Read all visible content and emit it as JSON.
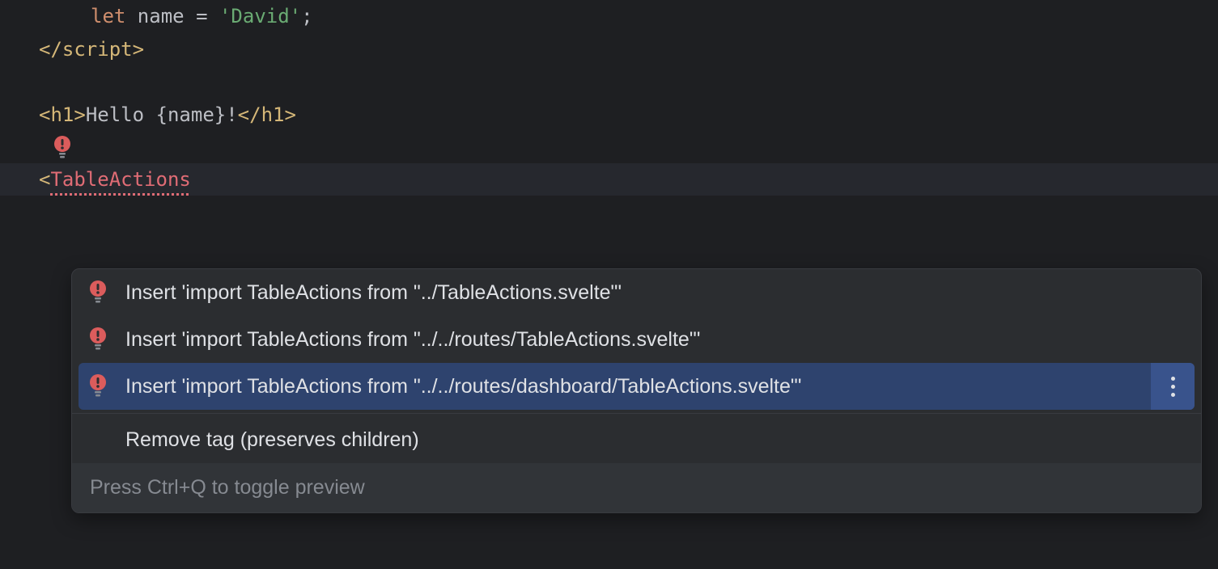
{
  "code": {
    "line1_keyword": "let",
    "line1_var": " name ",
    "line1_eq": "= ",
    "line1_string": "'David'",
    "line1_semi": ";",
    "line2_close": "</",
    "line2_tag": "script",
    "line2_gt": ">",
    "line4_open": "<",
    "line4_h1": "h1",
    "line4_gt": ">",
    "line4_hello": "Hello ",
    "line4_lbrace": "{",
    "line4_name": "name",
    "line4_rbrace": "}",
    "line4_bang": "!",
    "line4_close": "</",
    "line4_h1b": "h1",
    "line4_gt2": ">",
    "line6_lt": "<",
    "line6_comp": "TableActions"
  },
  "popup": {
    "items": [
      "Insert 'import TableActions from \"../TableActions.svelte\"'",
      "Insert 'import TableActions from \"../../routes/TableActions.svelte\"'",
      "Insert 'import TableActions from \"../../routes/dashboard/TableActions.svelte\"'",
      "Remove tag (preserves children)"
    ],
    "footer": "Press Ctrl+Q to toggle preview"
  }
}
